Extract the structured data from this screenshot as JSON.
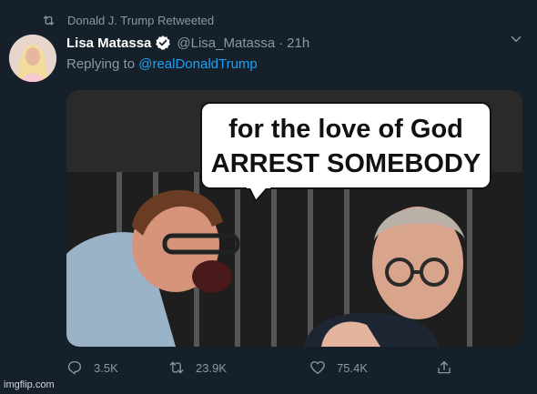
{
  "retweet": {
    "icon": "retweet-icon",
    "text": "Donald J. Trump Retweeted"
  },
  "tweet": {
    "display_name": "Lisa Matassa",
    "verified_icon": "verified-badge-icon",
    "handle": "@Lisa_Matassa",
    "separator": "·",
    "time": "21h",
    "reply_prefix": "Replying to",
    "reply_mention": "@realDonaldTrump",
    "more_icon": "chevron-down-icon"
  },
  "media": {
    "caption_line1": "for the love of God",
    "caption_line2": "ARREST SOMEBODY"
  },
  "actions": {
    "reply_count": "3.5K",
    "retweet_count": "23.9K",
    "like_count": "75.4K",
    "share_icon": "share-icon"
  },
  "watermark": "imgflip.com",
  "colors": {
    "background": "#15202b",
    "secondary_text": "#8899a6",
    "link": "#1da1f2",
    "verified": "#1da1f2"
  }
}
